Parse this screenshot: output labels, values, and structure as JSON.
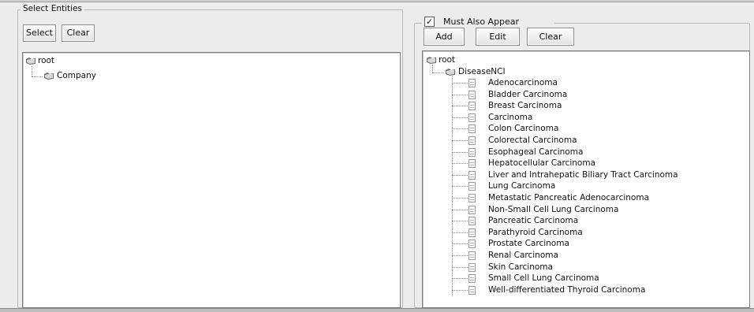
{
  "left_panel": {
    "title": "Select Entities",
    "buttons": {
      "select": "Select",
      "clear": "Clear"
    },
    "tree": {
      "root": "root",
      "children": [
        "Company"
      ]
    }
  },
  "right_panel": {
    "checkbox": {
      "label": "Must Also Appear",
      "checked": true,
      "mark": "✓"
    },
    "buttons": {
      "add": "Add",
      "edit": "Edit",
      "clear": "Clear"
    },
    "tree": {
      "root": "root",
      "category": "DiseaseNCI",
      "leaves": [
        "Adenocarcinoma",
        "Bladder Carcinoma",
        "Breast Carcinoma",
        "Carcinoma",
        "Colon Carcinoma",
        "Colorectal Carcinoma",
        "Esophageal Carcinoma",
        "Hepatocellular Carcinoma",
        "Liver and Intrahepatic Biliary Tract Carcinoma",
        "Lung Carcinoma",
        "Metastatic Pancreatic Adenocarcinoma",
        "Non-Small Cell Lung Carcinoma",
        "Pancreatic Carcinoma",
        "Parathyroid Carcinoma",
        "Prostate Carcinoma",
        "Renal Carcinoma",
        "Skin Carcinoma",
        "Small Cell Lung Carcinoma",
        "Well-differentiated Thyroid Carcinoma"
      ]
    }
  },
  "icons": {
    "folder": "folder-icon",
    "leaf": "document-icon",
    "checkbox": "check-icon"
  }
}
